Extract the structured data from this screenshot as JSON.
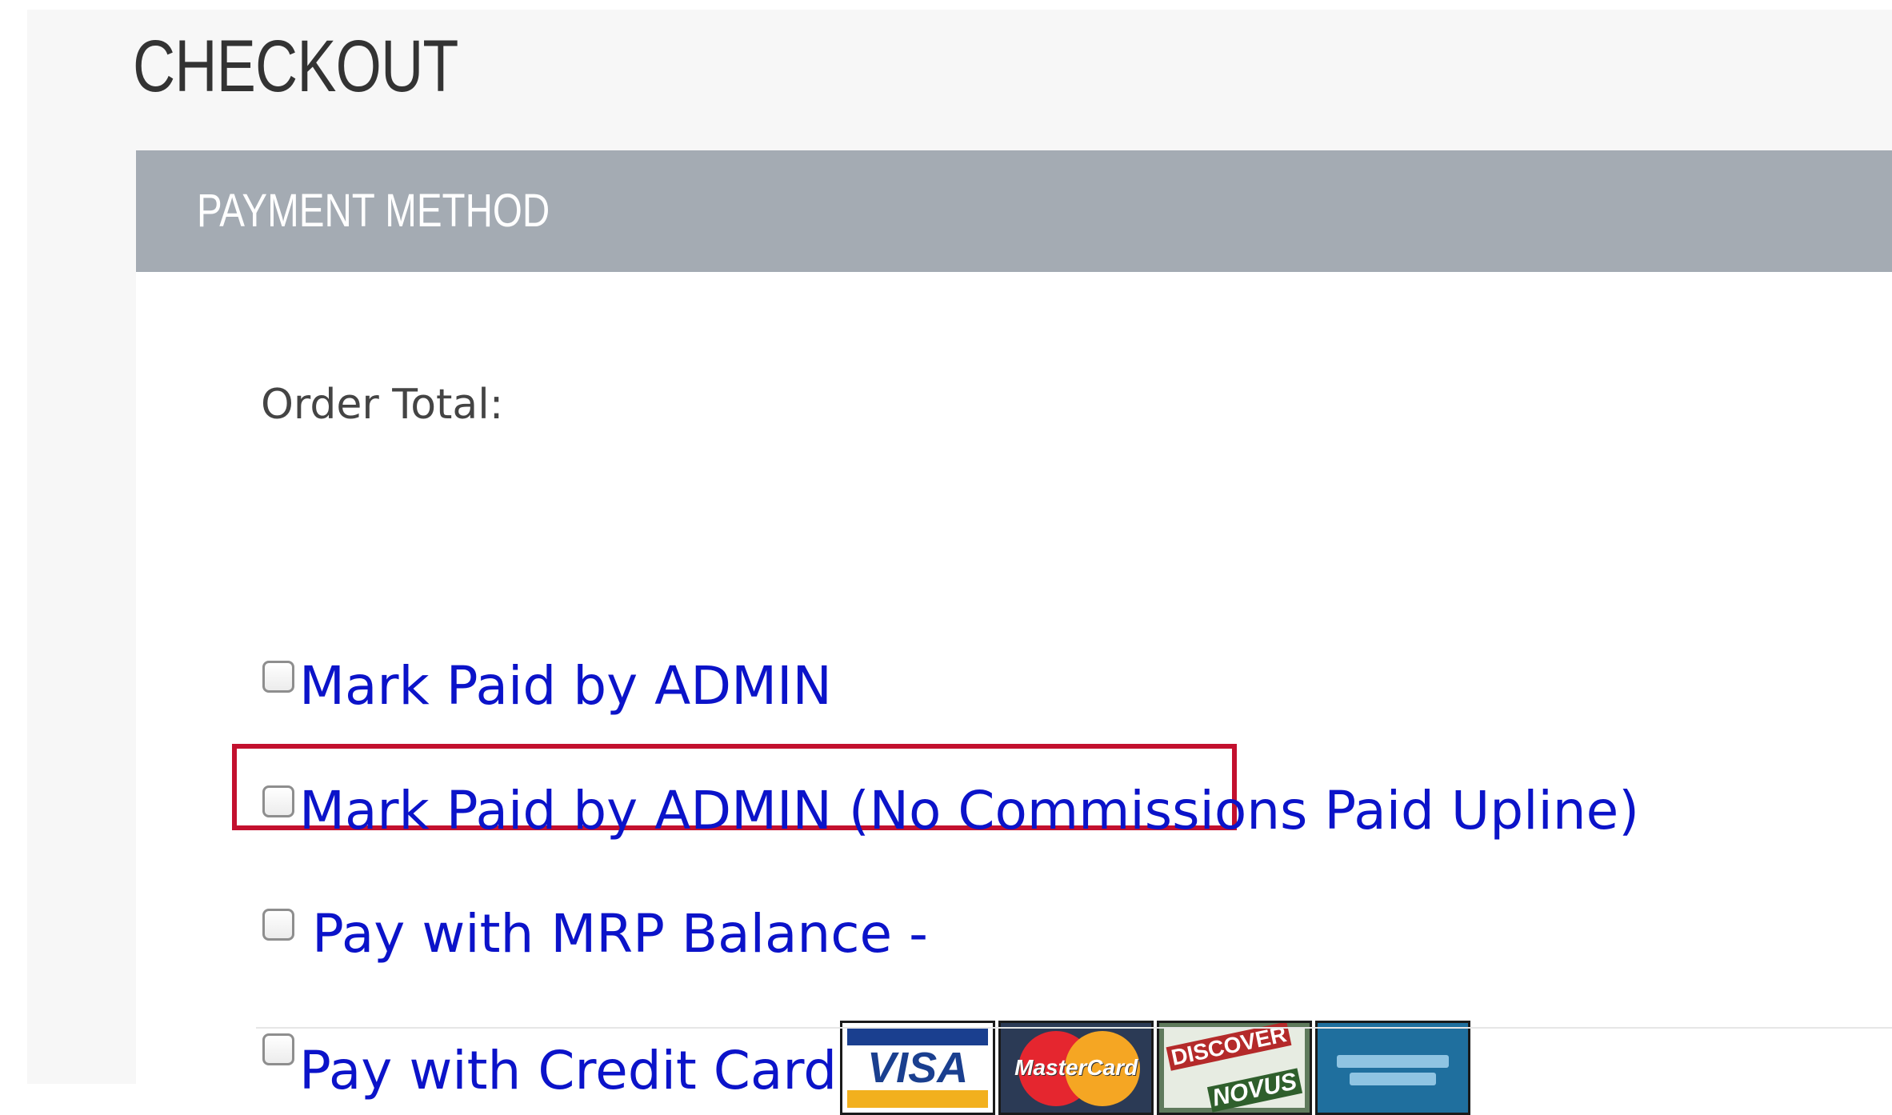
{
  "page": {
    "title": "CHECKOUT"
  },
  "panel": {
    "header_title": "PAYMENT METHOD",
    "order_total_label": "Order Total:"
  },
  "payment_options": [
    {
      "label": "Mark Paid by ADMIN",
      "checked": false
    },
    {
      "label": "Mark Paid by ADMIN (No Commissions Paid Upline)",
      "checked": false
    },
    {
      "label": "Pay with MRP Balance -",
      "checked": false,
      "highlighted": true
    },
    {
      "label": "Pay with Credit Card",
      "checked": false
    }
  ],
  "card_logos": [
    {
      "name": "visa-icon",
      "text": "VISA"
    },
    {
      "name": "mastercard-icon",
      "text": "MasterCard"
    },
    {
      "name": "discover-novus-icon",
      "text_top": "DISCOVER",
      "text_bottom": "NOVUS"
    },
    {
      "name": "american-express-icon"
    }
  ],
  "colors": {
    "header_bg": "#a4abb3",
    "link_blue": "#0b13c9",
    "highlight_red": "#c3102e",
    "page_bg": "#f7f7f7"
  }
}
